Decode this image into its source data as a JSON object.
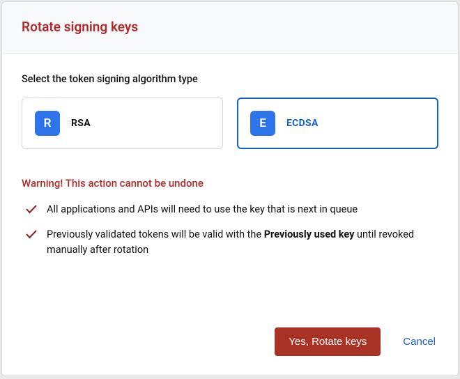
{
  "dialog": {
    "title": "Rotate signing keys",
    "section_label": "Select the token signing algorithm type",
    "options": [
      {
        "badge": "R",
        "label": "RSA",
        "selected": false
      },
      {
        "badge": "E",
        "label": "ECDSA",
        "selected": true
      }
    ],
    "warning_title": "Warning! This action cannot be undone",
    "bullets": [
      {
        "text": "All applications and APIs will need to use the key that is next in queue"
      },
      {
        "prefix": "Previously validated tokens will be valid with the ",
        "bold": "Previously used key",
        "suffix": " until revoked manually after rotation"
      }
    ],
    "confirm_label": "Yes, Rotate keys",
    "cancel_label": "Cancel"
  },
  "colors": {
    "danger": "#b02a2a",
    "danger_btn": "#a83224",
    "primary": "#1460d6",
    "badge": "#2e74ea"
  }
}
